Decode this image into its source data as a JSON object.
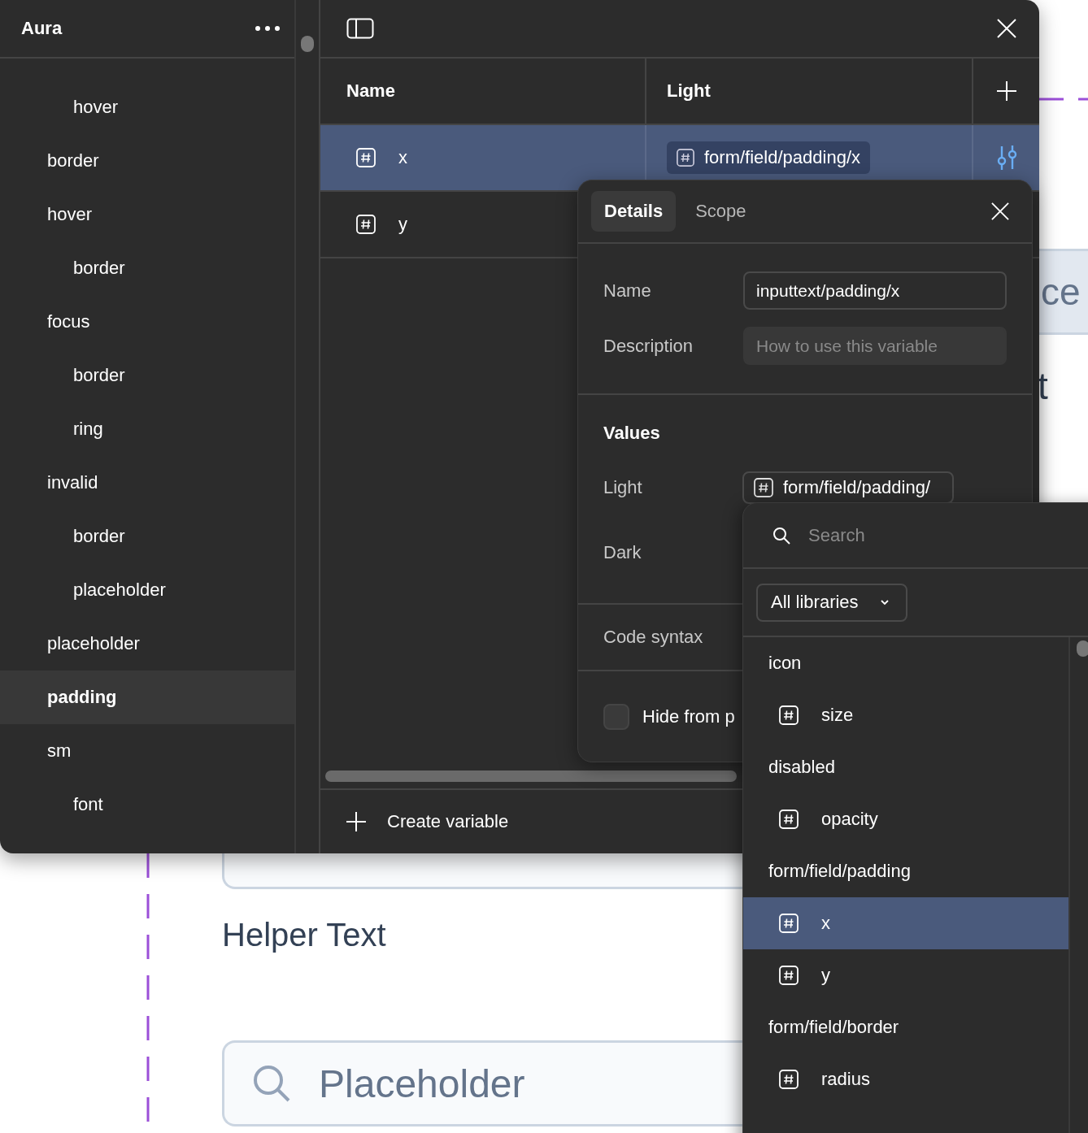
{
  "canvas": {
    "fragments": [
      "ce",
      "t"
    ],
    "helper_text": "Helper Text",
    "field_placeholder": "Placeholder"
  },
  "sidebar": {
    "title": "Aura",
    "leading_children": [
      {
        "label": "hover",
        "selected": false
      }
    ],
    "items": [
      {
        "label": "border",
        "selected": false
      },
      {
        "label": "hover",
        "selected": false,
        "children": [
          {
            "label": "border",
            "selected": false
          }
        ]
      },
      {
        "label": "focus",
        "selected": false,
        "children": [
          {
            "label": "border",
            "selected": false
          },
          {
            "label": "ring",
            "selected": false
          }
        ]
      },
      {
        "label": "invalid",
        "selected": false,
        "children": [
          {
            "label": "border",
            "selected": false
          },
          {
            "label": "placeholder",
            "selected": false
          }
        ]
      },
      {
        "label": "placeholder",
        "selected": false
      },
      {
        "label": "padding",
        "selected": true
      },
      {
        "label": "sm",
        "selected": false,
        "children": [
          {
            "label": "font",
            "selected": false
          }
        ]
      }
    ]
  },
  "table": {
    "columns": [
      "Name",
      "Light"
    ],
    "rows": [
      {
        "name": "x",
        "light": "form/field/padding/x",
        "selected": true
      },
      {
        "name": "y",
        "selected": false
      }
    ]
  },
  "footer": {
    "create_button": "Create variable"
  },
  "details": {
    "tabs": [
      {
        "label": "Details",
        "selected": true
      },
      {
        "label": "Scope",
        "selected": false
      }
    ],
    "fields": [
      {
        "label": "Name",
        "value": "inputtext/padding/x"
      },
      {
        "label": "Description",
        "placeholder": "How to use this variable"
      }
    ],
    "values_heading": "Values",
    "values": [
      {
        "label": "Light",
        "value": "form/field/padding/"
      },
      {
        "label": "Dark"
      }
    ],
    "code_syntax": "Code syntax",
    "hide_option": {
      "label": "Hide from p",
      "checked": false
    }
  },
  "picker": {
    "search_placeholder": "Search",
    "library_filter": "All libraries",
    "items": [
      {
        "kind": "group",
        "label": "icon",
        "selected": false
      },
      {
        "kind": "variable",
        "label": "size",
        "selected": false
      },
      {
        "kind": "group",
        "label": "disabled",
        "selected": false
      },
      {
        "kind": "variable",
        "label": "opacity",
        "selected": false
      },
      {
        "kind": "group",
        "label": "form/field/padding",
        "selected": false
      },
      {
        "kind": "variable",
        "label": "x",
        "selected": true
      },
      {
        "kind": "variable",
        "label": "y",
        "selected": false
      },
      {
        "kind": "group",
        "label": "form/field/border",
        "selected": false
      },
      {
        "kind": "variable",
        "label": "radius",
        "selected": false
      }
    ]
  }
}
